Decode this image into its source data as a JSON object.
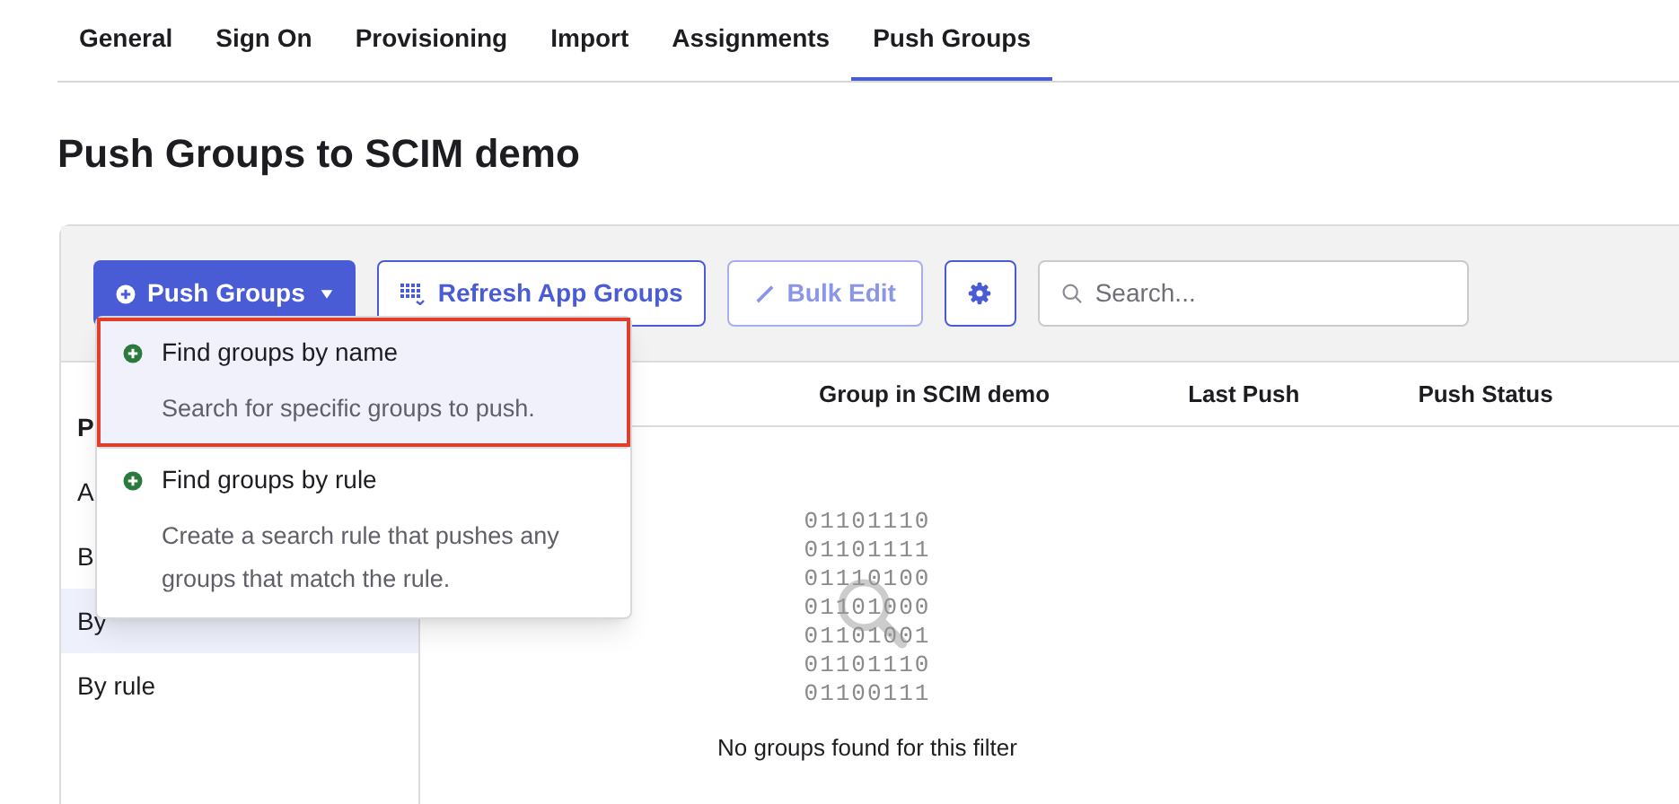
{
  "tabs": [
    {
      "label": "General",
      "selected": false
    },
    {
      "label": "Sign On",
      "selected": false
    },
    {
      "label": "Provisioning",
      "selected": false
    },
    {
      "label": "Import",
      "selected": false
    },
    {
      "label": "Assignments",
      "selected": false
    },
    {
      "label": "Push Groups",
      "selected": true
    }
  ],
  "title": "Push Groups to SCIM demo",
  "toolbar": {
    "push_button": "Push Groups",
    "refresh_button": "Refresh App Groups",
    "bulk_edit_button": {
      "label": "Bulk Edit",
      "disabled": true
    },
    "search": {
      "placeholder": "Search..."
    }
  },
  "sidebar": {
    "items": [
      {
        "label": "P",
        "kind": "heading",
        "selected": false
      },
      {
        "label": "A",
        "kind": "item",
        "selected": false
      },
      {
        "label": "B",
        "kind": "item",
        "selected": false
      },
      {
        "label": "By",
        "kind": "item",
        "selected": true
      },
      {
        "label": "By rule",
        "kind": "item",
        "selected": false
      }
    ]
  },
  "table": {
    "columns": [
      "Group in SCIM demo",
      "Last Push",
      "Push Status"
    ],
    "empty": {
      "binary_lines": [
        "01101110",
        "01101111",
        "01110100",
        "01101000",
        "01101001",
        "01101110",
        "01100111"
      ],
      "message": "No groups found for this filter"
    }
  },
  "dropdown": {
    "items": [
      {
        "title": "Find groups by name",
        "description": "Search for specific groups to push.",
        "highlighted": true
      },
      {
        "title": "Find groups by rule",
        "description": "Create a search rule that pushes any groups that match the rule.",
        "highlighted": false
      }
    ]
  }
}
